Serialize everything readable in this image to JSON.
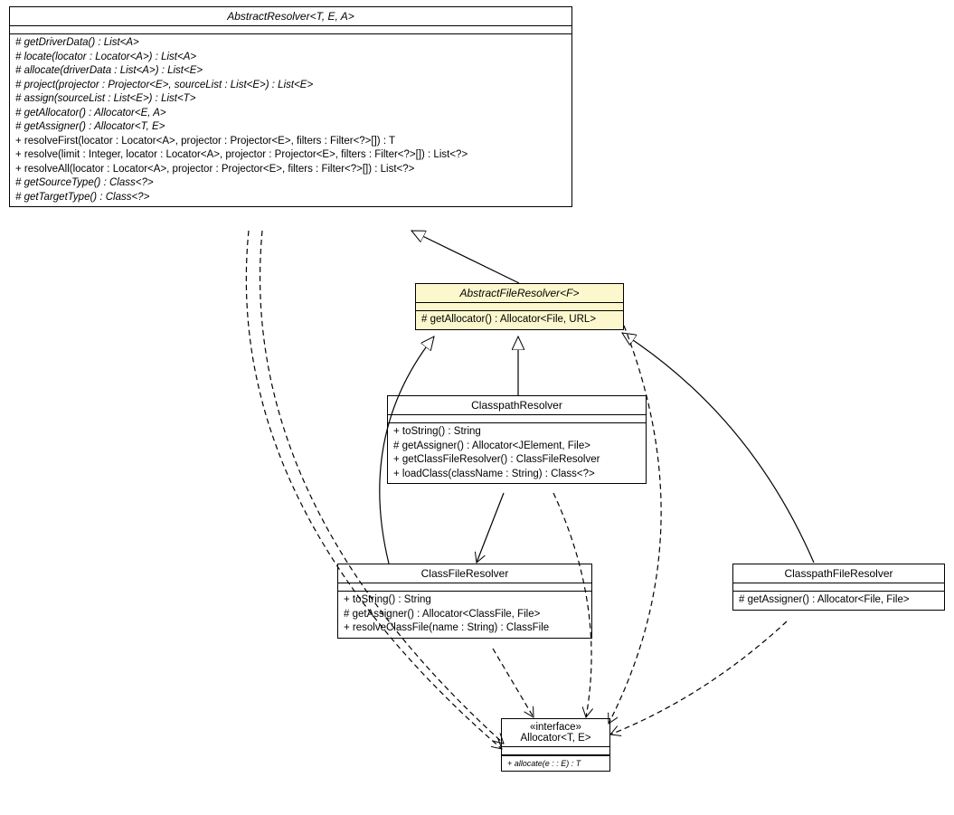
{
  "chart_data": {
    "type": "diagram",
    "diagram_kind": "UML class diagram",
    "classes": [
      {
        "id": "abstractResolver",
        "name": "AbstractResolver<T, E, A>",
        "abstract": true,
        "methods": [
          "# getDriverData() : List<A>",
          "# locate(locator : Locator<A>) : List<A>",
          "# allocate(driverData : List<A>) : List<E>",
          "# project(projector : Projector<E>, sourceList : List<E>) : List<E>",
          "# assign(sourceList : List<E>) : List<T>",
          "# getAllocator() : Allocator<E, A>",
          "# getAssigner() : Allocator<T, E>",
          "+ resolveFirst(locator : Locator<A>, projector : Projector<E>, filters : Filter<?>[]) : T",
          "+ resolve(limit : Integer, locator : Locator<A>, projector : Projector<E>, filters : Filter<?>[]) : List<?>",
          "+ resolveAll(locator : Locator<A>, projector : Projector<E>, filters : Filter<?>[]) : List<?>",
          "# getSourceType() : Class<?>",
          "# getTargetType() : Class<?>"
        ]
      },
      {
        "id": "abstractFileResolver",
        "name": "AbstractFileResolver<F>",
        "abstract": true,
        "highlight": true,
        "methods": [
          "# getAllocator() : Allocator<File, URL>"
        ]
      },
      {
        "id": "classpathResolver",
        "name": "ClasspathResolver",
        "methods": [
          "+ toString() : String",
          "# getAssigner() : Allocator<JElement, File>",
          "+ getClassFileResolver() : ClassFileResolver",
          "+ loadClass(className : String) : Class<?>"
        ]
      },
      {
        "id": "classFileResolver",
        "name": "ClassFileResolver",
        "methods": [
          "+ toString() : String",
          "# getAssigner() : Allocator<ClassFile, File>",
          "+ resolveClassFile(name : String) : ClassFile"
        ]
      },
      {
        "id": "classpathFileResolver",
        "name": "ClasspathFileResolver",
        "methods": [
          "# getAssigner() : Allocator<File, File>"
        ]
      },
      {
        "id": "allocator",
        "name": "Allocator<T, E>",
        "stereotype": "«interface»",
        "methods": [
          "+ allocate(e :  : E) : T"
        ]
      }
    ],
    "relationships": [
      {
        "from": "abstractFileResolver",
        "to": "abstractResolver",
        "type": "generalization"
      },
      {
        "from": "classpathResolver",
        "to": "abstractFileResolver",
        "type": "generalization"
      },
      {
        "from": "classFileResolver",
        "to": "abstractFileResolver",
        "type": "generalization"
      },
      {
        "from": "classpathFileResolver",
        "to": "abstractFileResolver",
        "type": "generalization"
      },
      {
        "from": "classpathResolver",
        "to": "classFileResolver",
        "type": "association"
      },
      {
        "from": "abstractResolver",
        "to": "allocator",
        "type": "dependency"
      },
      {
        "from": "abstractFileResolver",
        "to": "allocator",
        "type": "dependency"
      },
      {
        "from": "classpathResolver",
        "to": "allocator",
        "type": "dependency"
      },
      {
        "from": "classFileResolver",
        "to": "allocator",
        "type": "dependency"
      },
      {
        "from": "classpathFileResolver",
        "to": "allocator",
        "type": "dependency"
      }
    ]
  },
  "classes": {
    "abstractResolver": {
      "title": "AbstractResolver<T, E, A>",
      "m0": "# getDriverData() : List<A>",
      "m1": "# locate(locator : Locator<A>) : List<A>",
      "m2": "# allocate(driverData : List<A>) : List<E>",
      "m3": "# project(projector : Projector<E>, sourceList : List<E>) : List<E>",
      "m4": "# assign(sourceList : List<E>) : List<T>",
      "m5": "# getAllocator() : Allocator<E, A>",
      "m6": "# getAssigner() : Allocator<T, E>",
      "m7": "+ resolveFirst(locator : Locator<A>, projector : Projector<E>, filters : Filter<?>[]) : T",
      "m8": "+ resolve(limit : Integer, locator : Locator<A>, projector : Projector<E>, filters : Filter<?>[]) : List<?>",
      "m9": "+ resolveAll(locator : Locator<A>, projector : Projector<E>, filters : Filter<?>[]) : List<?>",
      "m10": "# getSourceType() : Class<?>",
      "m11": "# getTargetType() : Class<?>"
    },
    "abstractFileResolver": {
      "title": "AbstractFileResolver<F>",
      "m0": "# getAllocator() : Allocator<File, URL>"
    },
    "classpathResolver": {
      "title": "ClasspathResolver",
      "m0": "+ toString() : String",
      "m1": "# getAssigner() : Allocator<JElement, File>",
      "m2": "+ getClassFileResolver() : ClassFileResolver",
      "m3": "+ loadClass(className : String) : Class<?>"
    },
    "classFileResolver": {
      "title": "ClassFileResolver",
      "m0": "+ toString() : String",
      "m1": "# getAssigner() : Allocator<ClassFile, File>",
      "m2": "+ resolveClassFile(name : String) : ClassFile"
    },
    "classpathFileResolver": {
      "title": "ClasspathFileResolver",
      "m0": "# getAssigner() : Allocator<File, File>"
    },
    "allocator": {
      "stereotype": "«interface»",
      "title": "Allocator<T, E>",
      "m0": "+ allocate(e :  : E) : T"
    }
  }
}
